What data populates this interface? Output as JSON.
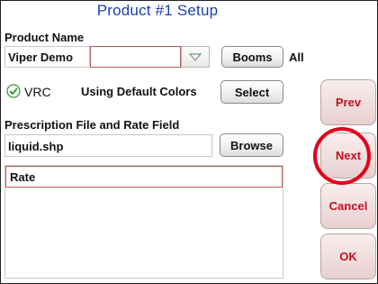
{
  "title": "Product #1 Setup",
  "product_name": {
    "label": "Product Name",
    "value": "Viper Demo",
    "booms_label": "Booms",
    "booms_value": "All"
  },
  "vrc": {
    "label": "VRC",
    "checked": true,
    "colors_text": "Using Default Colors",
    "select_label": "Select"
  },
  "prescription": {
    "label": "Prescription File and Rate Field",
    "file_value": "liquid.shp",
    "browse_label": "Browse",
    "fields": [
      "Rate"
    ]
  },
  "side_buttons": {
    "prev": "Prev",
    "next": "Next",
    "cancel": "Cancel",
    "ok": "OK"
  },
  "colors": {
    "title": "#1b3fb0",
    "side_button_text": "#c40f1e",
    "highlight_ring": "#e2001a",
    "check_green": "#3a9a3a"
  }
}
